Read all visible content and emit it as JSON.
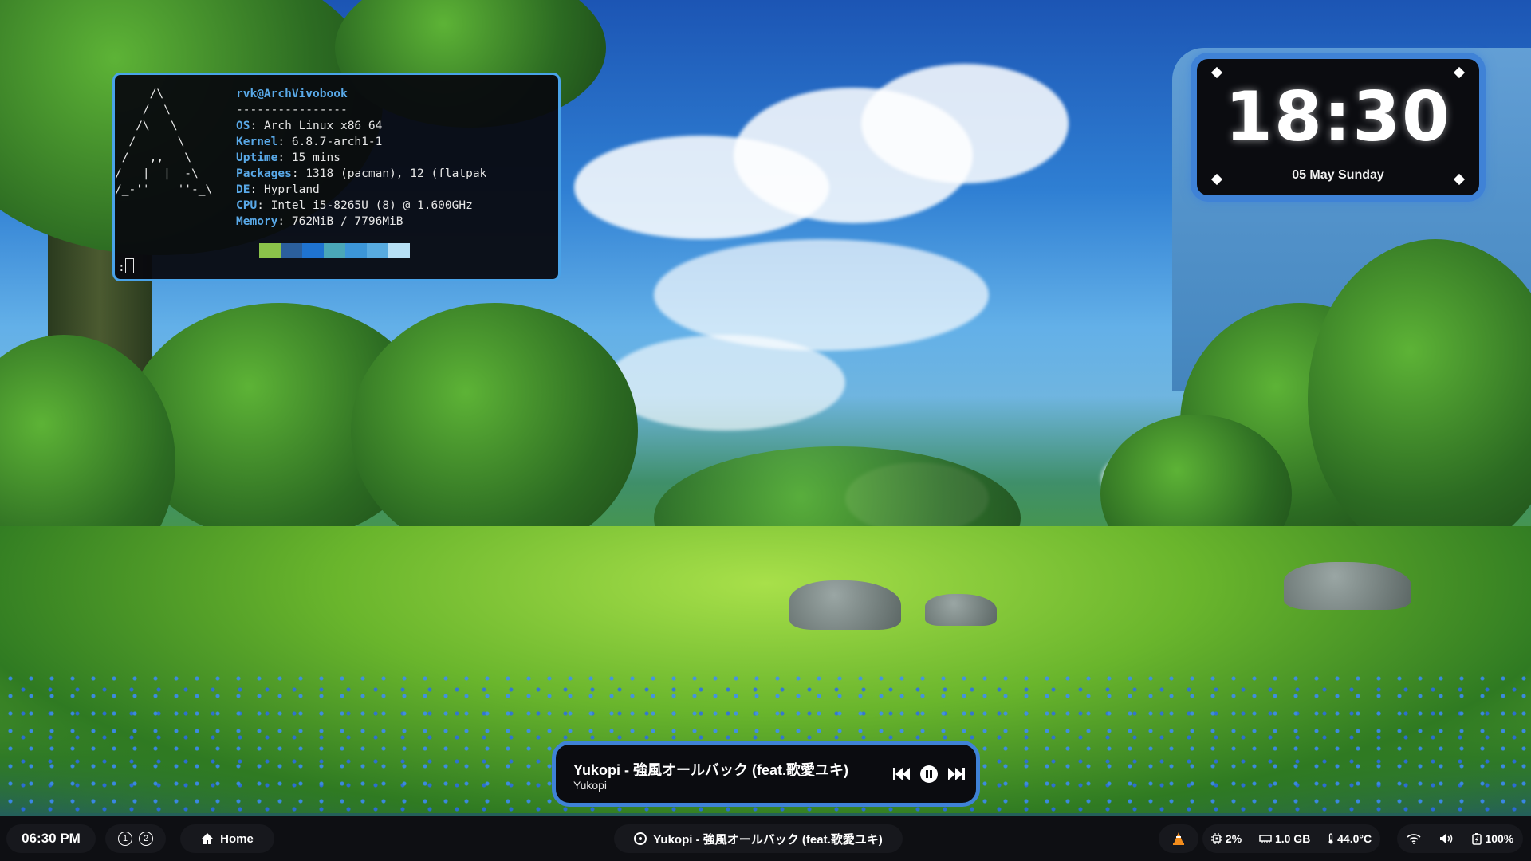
{
  "terminal": {
    "logo": "     /\\\n    /  \\\n   /\\   \\\n  /      \\\n /   ,,   \\\n/   |  |  -\\\n/_-''    ''-_\\",
    "userhost": "rvk@ArchVivobook",
    "separator": "----------------",
    "rows": [
      {
        "key": "OS",
        "value": "Arch Linux x86_64"
      },
      {
        "key": "Kernel",
        "value": "6.8.7-arch1-1"
      },
      {
        "key": "Uptime",
        "value": "15 mins"
      },
      {
        "key": "Packages",
        "value": "1318 (pacman), 12 (flatpak"
      },
      {
        "key": "DE",
        "value": "Hyprland"
      },
      {
        "key": "CPU",
        "value": "Intel i5-8265U (8) @ 1.600GHz"
      },
      {
        "key": "Memory",
        "value": "762MiB / 7796MiB"
      }
    ],
    "palette": [
      "#8bc34a",
      "#2b5f9c",
      "#1f73d0",
      "#4aa7b8",
      "#3c96d8",
      "#58abe0",
      "#b7e0f5"
    ],
    "prompt": ":"
  },
  "clock": {
    "time": "18:30",
    "date": "05 May Sunday"
  },
  "media": {
    "title": "Yukopi - 強風オールバック (feat.歌愛ユキ)",
    "artist": "Yukopi",
    "controls": [
      "previous-icon",
      "pause-icon",
      "next-icon"
    ]
  },
  "bar": {
    "time": "06:30 PM",
    "workspaces": [
      "1",
      "2"
    ],
    "home_label": "Home",
    "now_playing": "Yukopi - 強風オールバック (feat.歌愛ユキ)",
    "cpu": "2%",
    "memory": "1.0 GB",
    "temperature": "44.0°C",
    "battery": "100%"
  }
}
